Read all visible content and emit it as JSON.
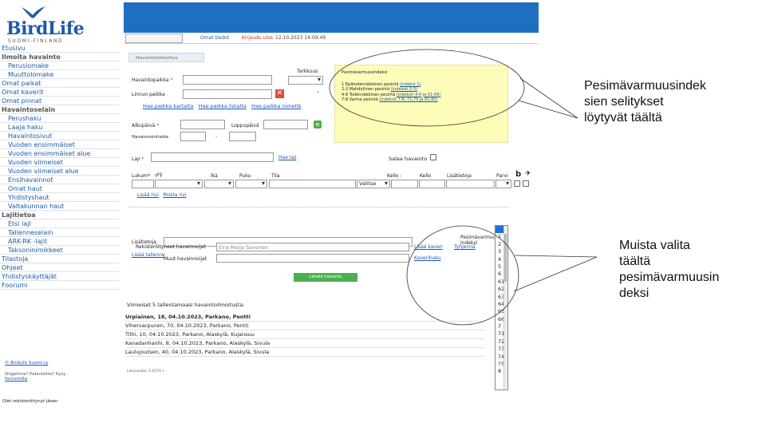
{
  "logo": {
    "word": "BirdLife",
    "sub": "SUOMI-FINLAND"
  },
  "userbar": {
    "own_info": "Omat tiedot",
    "logout": "Kirjaudu ulos",
    "datetime": "12.10.2023 14:09:49"
  },
  "sidebar": {
    "items": [
      {
        "label": "Etusivu",
        "kind": "link"
      },
      {
        "label": "Ilmoita havainto",
        "kind": "section"
      },
      {
        "label": "Peruslomake",
        "kind": "sub"
      },
      {
        "label": "Muuttolomake",
        "kind": "sub"
      },
      {
        "label": "Omat paikat",
        "kind": "link"
      },
      {
        "label": "Omat kaverit",
        "kind": "link"
      },
      {
        "label": "Omat pinnat",
        "kind": "link"
      },
      {
        "label": "Havaintoselain",
        "kind": "section"
      },
      {
        "label": "Perushaku",
        "kind": "sub"
      },
      {
        "label": "Laaja haku",
        "kind": "sub"
      },
      {
        "label": "Havaintosivut",
        "kind": "sub"
      },
      {
        "label": "Vuoden ensimmäiset",
        "kind": "sub"
      },
      {
        "label": "Vuoden ensimmäiset alue",
        "kind": "sub"
      },
      {
        "label": "Vuoden viimeiset",
        "kind": "sub"
      },
      {
        "label": "Vuoden viimeiset alue",
        "kind": "sub"
      },
      {
        "label": "Ensihavainnot",
        "kind": "sub"
      },
      {
        "label": "Omat haut",
        "kind": "sub"
      },
      {
        "label": "Yhdistyshaut",
        "kind": "sub"
      },
      {
        "label": "Valtakunnan haut",
        "kind": "sub"
      },
      {
        "label": "Lajitietoa",
        "kind": "section"
      },
      {
        "label": "Etsi lajI",
        "kind": "sub"
      },
      {
        "label": "Tallenneselain",
        "kind": "sub"
      },
      {
        "label": "ARK-RK -lajit",
        "kind": "sub"
      },
      {
        "label": "Taksoninimikkeet",
        "kind": "sub"
      },
      {
        "label": "Tilastoja",
        "kind": "link"
      },
      {
        "label": "Ohjeet",
        "kind": "link"
      },
      {
        "label": "Yhdistyskäyttäjät",
        "kind": "link"
      },
      {
        "label": "Foorumi",
        "kind": "link"
      }
    ],
    "copyright": "© BirdLife Suomi ry",
    "problems": "Ongelmia? Palautetta? Kysy",
    "forum_link": "foorumilta",
    "member": "Olet rekisteröitynyt jäsen"
  },
  "form": {
    "tab": "Havaintoilmoitus",
    "place_label": "Havaintopaikka",
    "accuracy_label": "Tarkkuus",
    "bird_place_label": "Linnun paikka",
    "place_links": [
      "Hae paikka kartalta",
      "Hae paikka listalta",
      "Hae paikka nimellä"
    ],
    "start_label": "Alkupäivä",
    "end_label": "Loppupäivä",
    "time_label": "Havainnointiaika",
    "time_sep": "-",
    "species_label": "Laji",
    "species_link": "Hae laji",
    "secret_label": "Salaa havainto",
    "cols": {
      "count": "Lukum*",
      "sex": "♂♀",
      "age": "Ikä",
      "plumage": "Puku",
      "state": "Tila",
      "time_from": "Kello -",
      "time_to": "Kello",
      "extra": "Lisätietoja",
      "flock": "Parvi",
      "b": "b"
    },
    "state_select": "Valitse",
    "row_links": [
      "Lisää rivi",
      "Poista rivi"
    ],
    "extra_label": "Lisätietoja",
    "breeding_label": "Pesimävarmuus-",
    "breeding_label2": "indeksi",
    "add_extra": "Lisää tallenne",
    "registered_label": "Rekisteröityneet havainnoijat",
    "registered_value": "Eira-Maija Savonen",
    "add_friend": "Lisää kaveri",
    "clear": "Tyhjennä",
    "friend_circle": "Kaverihaku",
    "other_label": "Muut havainnoijat",
    "submit": "Lähetä havainto"
  },
  "info_box": {
    "title": "Pesimävarmuusindeksi",
    "lines": [
      {
        "text": "1 Epätodennäköinen pesintä ",
        "link": "(indeksi 1)"
      },
      {
        "text": "2-3 Mahdollinen pesintä ",
        "link": "(indeksit 2-3)"
      },
      {
        "text": "4-6 Todennäköinen pesintä ",
        "link": "(indeksit 4-6 ja 61-66)"
      },
      {
        "text": "7-8 Varma pesintä ",
        "link": "(indeksit 7-8, 71-75 ja 81-82)"
      }
    ]
  },
  "recent": {
    "title": "Viimeiset 5 tallentamaasi havaintoilmoitusta:",
    "rows": [
      "Urpiainen, 18, 04.10.2023, Parkano, Pentti",
      "Vihervarpunen, 70, 04.10.2023, Parkano, Pentti",
      "Tilhi, 10, 04.10.2023, Parkano, Alaskylä, Kujansuu",
      "Kanadanhanhi, 8, 04.10.2023, Parkano, Alaskylä, Sivula",
      "Laulujoutsen, 40, 04.10.2023, Parkano, Alaskylä, Sivula"
    ],
    "load_time": "Latausaika: 0.0570 s"
  },
  "dropdown": {
    "options": [
      "",
      "1",
      "2",
      "3",
      "4",
      "5",
      "6",
      "61",
      "62",
      "63",
      "64",
      "65",
      "66",
      "7",
      "71",
      "72",
      "73",
      "74",
      "75",
      "8"
    ]
  },
  "annotations": {
    "top": [
      "Pesimävarmuusindek",
      "sien selitykset",
      "löytyvät täältä"
    ],
    "bottom": [
      "Muista valita",
      "täältä",
      "pesimävarmuusin",
      "deksi"
    ]
  },
  "colors": {
    "brand_blue": "#1e6fc0",
    "info_yellow": "#fdfcb8",
    "submit_green": "#4caf50",
    "required_red": "#dd2222"
  }
}
